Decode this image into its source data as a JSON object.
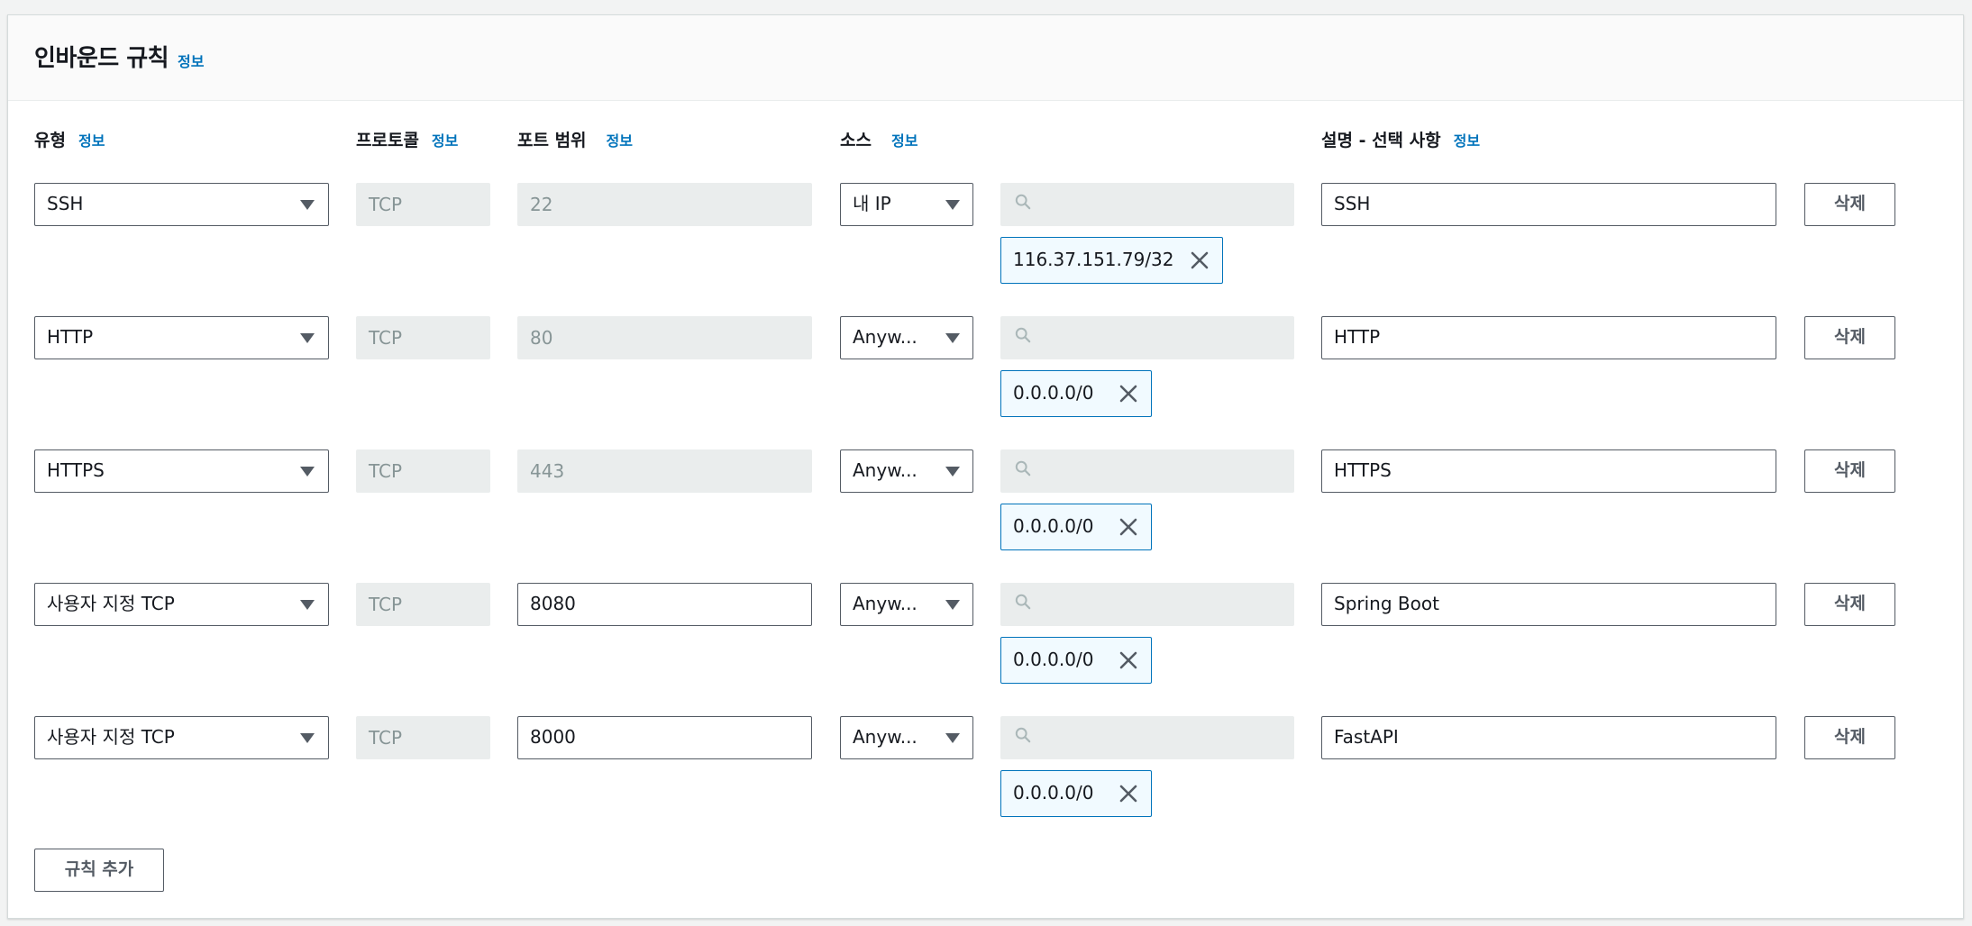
{
  "section": {
    "title": "인바운드 규칙",
    "info_label": "정보"
  },
  "columns": {
    "type": "유형",
    "protocol": "프로토콜",
    "port_range": "포트 범위",
    "source": "소스",
    "description": "설명 - 선택 사항",
    "info_label": "정보"
  },
  "rules": [
    {
      "type": "SSH",
      "protocol": "TCP",
      "port": "22",
      "port_editable": false,
      "source_type": "내 IP",
      "source_search": "",
      "cidr": "116.37.151.79/32",
      "description": "SSH",
      "delete_label": "삭제"
    },
    {
      "type": "HTTP",
      "protocol": "TCP",
      "port": "80",
      "port_editable": false,
      "source_type": "Anyw...",
      "source_search": "",
      "cidr": "0.0.0.0/0",
      "description": "HTTP",
      "delete_label": "삭제"
    },
    {
      "type": "HTTPS",
      "protocol": "TCP",
      "port": "443",
      "port_editable": false,
      "source_type": "Anyw...",
      "source_search": "",
      "cidr": "0.0.0.0/0",
      "description": "HTTPS",
      "delete_label": "삭제"
    },
    {
      "type": "사용자 지정 TCP",
      "protocol": "TCP",
      "port": "8080",
      "port_editable": true,
      "source_type": "Anyw...",
      "source_search": "",
      "cidr": "0.0.0.0/0",
      "description": "Spring Boot",
      "delete_label": "삭제"
    },
    {
      "type": "사용자 지정 TCP",
      "protocol": "TCP",
      "port": "8000",
      "port_editable": true,
      "source_type": "Anyw...",
      "source_search": "",
      "cidr": "0.0.0.0/0",
      "description": "FastAPI",
      "delete_label": "삭제"
    }
  ],
  "add_rule_label": "규칙 추가",
  "colors": {
    "link": "#0073bb",
    "border": "#545b64",
    "disabled_bg": "#eaeded",
    "token_bg": "#f1faff"
  }
}
